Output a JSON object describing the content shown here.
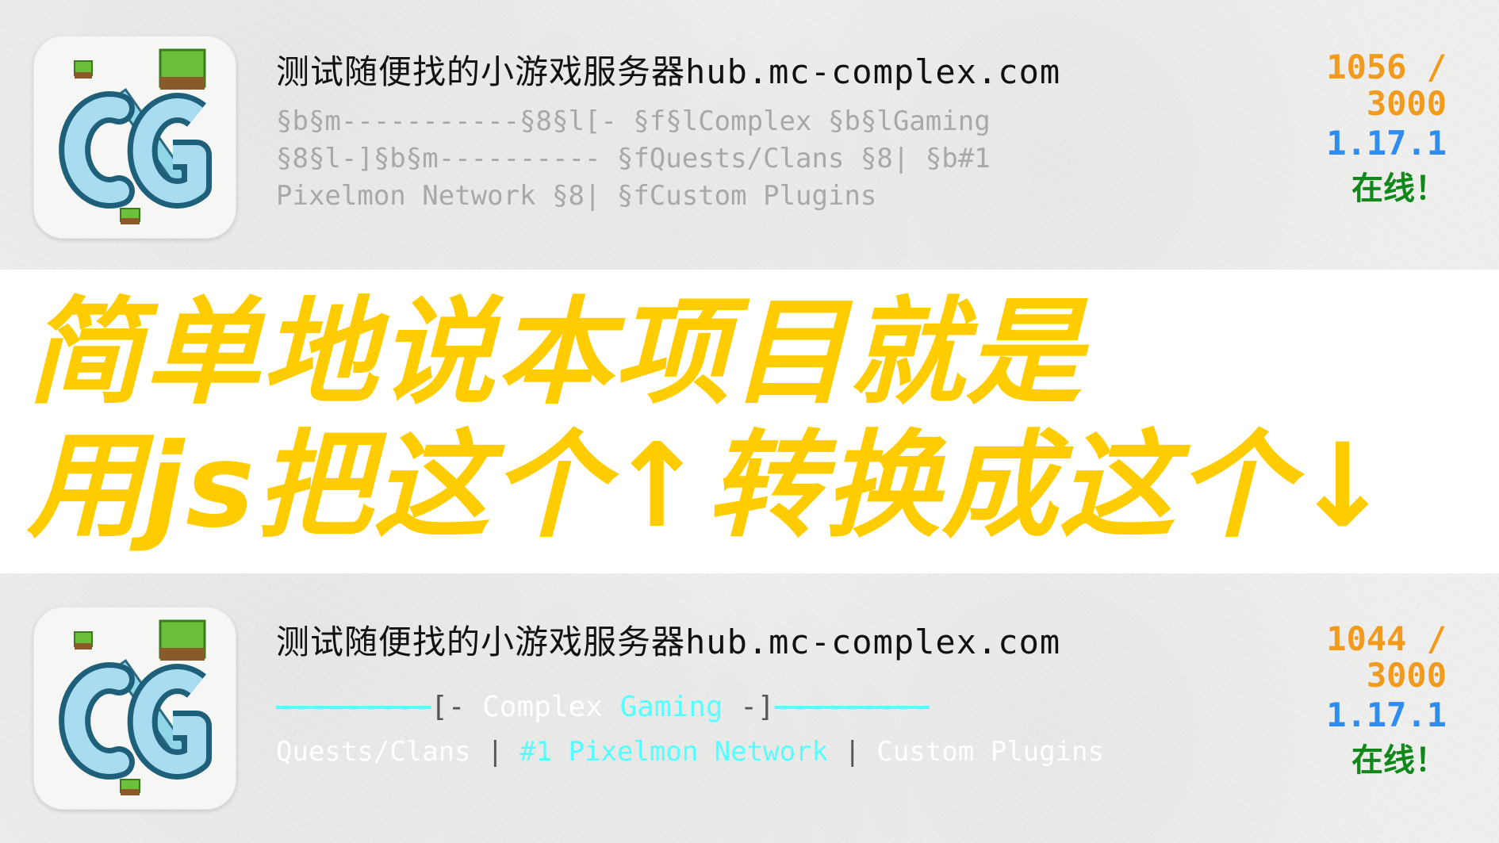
{
  "top_entry": {
    "server_name": "测试随便找的小游戏服务器hub.mc-complex.com",
    "motd_raw": "§b§m-----------§8§l[- §f§lComplex §b§lGaming §8§l-]§b§m---------- §fQuests/Clans §8| §b#1 Pixelmon Network §8| §fCustom Plugins",
    "players": "1056 / 3000",
    "version": "1.17.1",
    "status": "在线！"
  },
  "caption": {
    "line1": "简单地说本项目就是",
    "line2": "用js把这个↑转换成这个↓",
    "color": "#ffcc00"
  },
  "bottom_entry": {
    "server_name": "测试随便找的小游戏服务器hub.mc-complex.com",
    "motd": {
      "line1": [
        {
          "text": "---------",
          "color": "#55ffff",
          "strike": true
        },
        {
          "text": "[- ",
          "color": "#555555",
          "strike": false
        },
        {
          "text": "Complex ",
          "color": "#ffffff",
          "strike": false
        },
        {
          "text": "Gaming",
          "color": "#55ffff",
          "strike": false
        },
        {
          "text": " -]",
          "color": "#555555",
          "strike": false
        },
        {
          "text": "---------",
          "color": "#55ffff",
          "strike": true
        }
      ],
      "line2": [
        {
          "text": "Quests/Clans",
          "color": "#ffffff"
        },
        {
          "text": " | ",
          "color": "#555555"
        },
        {
          "text": "#1 Pixelmon Network",
          "color": "#55ffff"
        },
        {
          "text": " | ",
          "color": "#555555"
        },
        {
          "text": "Custom Plugins",
          "color": "#ffffff"
        }
      ]
    },
    "players": "1044 / 3000",
    "version": "1.17.1",
    "status": "在线！"
  },
  "colors": {
    "players": "#f29a1b",
    "version": "#2f8cf0",
    "status": "#11871c",
    "motd_raw": "#a8a8a8"
  },
  "icon": "server-favicon-cg-logo"
}
